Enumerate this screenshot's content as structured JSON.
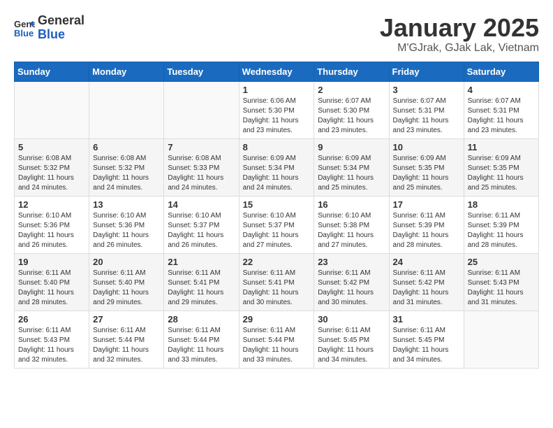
{
  "header": {
    "logo_line1": "General",
    "logo_line2": "Blue",
    "month_year": "January 2025",
    "location": "M'GJrak, GJak Lak, Vietnam"
  },
  "weekdays": [
    "Sunday",
    "Monday",
    "Tuesday",
    "Wednesday",
    "Thursday",
    "Friday",
    "Saturday"
  ],
  "weeks": [
    [
      {
        "day": "",
        "info": ""
      },
      {
        "day": "",
        "info": ""
      },
      {
        "day": "",
        "info": ""
      },
      {
        "day": "1",
        "info": "Sunrise: 6:06 AM\nSunset: 5:30 PM\nDaylight: 11 hours\nand 23 minutes."
      },
      {
        "day": "2",
        "info": "Sunrise: 6:07 AM\nSunset: 5:30 PM\nDaylight: 11 hours\nand 23 minutes."
      },
      {
        "day": "3",
        "info": "Sunrise: 6:07 AM\nSunset: 5:31 PM\nDaylight: 11 hours\nand 23 minutes."
      },
      {
        "day": "4",
        "info": "Sunrise: 6:07 AM\nSunset: 5:31 PM\nDaylight: 11 hours\nand 23 minutes."
      }
    ],
    [
      {
        "day": "5",
        "info": "Sunrise: 6:08 AM\nSunset: 5:32 PM\nDaylight: 11 hours\nand 24 minutes."
      },
      {
        "day": "6",
        "info": "Sunrise: 6:08 AM\nSunset: 5:32 PM\nDaylight: 11 hours\nand 24 minutes."
      },
      {
        "day": "7",
        "info": "Sunrise: 6:08 AM\nSunset: 5:33 PM\nDaylight: 11 hours\nand 24 minutes."
      },
      {
        "day": "8",
        "info": "Sunrise: 6:09 AM\nSunset: 5:34 PM\nDaylight: 11 hours\nand 24 minutes."
      },
      {
        "day": "9",
        "info": "Sunrise: 6:09 AM\nSunset: 5:34 PM\nDaylight: 11 hours\nand 25 minutes."
      },
      {
        "day": "10",
        "info": "Sunrise: 6:09 AM\nSunset: 5:35 PM\nDaylight: 11 hours\nand 25 minutes."
      },
      {
        "day": "11",
        "info": "Sunrise: 6:09 AM\nSunset: 5:35 PM\nDaylight: 11 hours\nand 25 minutes."
      }
    ],
    [
      {
        "day": "12",
        "info": "Sunrise: 6:10 AM\nSunset: 5:36 PM\nDaylight: 11 hours\nand 26 minutes."
      },
      {
        "day": "13",
        "info": "Sunrise: 6:10 AM\nSunset: 5:36 PM\nDaylight: 11 hours\nand 26 minutes."
      },
      {
        "day": "14",
        "info": "Sunrise: 6:10 AM\nSunset: 5:37 PM\nDaylight: 11 hours\nand 26 minutes."
      },
      {
        "day": "15",
        "info": "Sunrise: 6:10 AM\nSunset: 5:37 PM\nDaylight: 11 hours\nand 27 minutes."
      },
      {
        "day": "16",
        "info": "Sunrise: 6:10 AM\nSunset: 5:38 PM\nDaylight: 11 hours\nand 27 minutes."
      },
      {
        "day": "17",
        "info": "Sunrise: 6:11 AM\nSunset: 5:39 PM\nDaylight: 11 hours\nand 28 minutes."
      },
      {
        "day": "18",
        "info": "Sunrise: 6:11 AM\nSunset: 5:39 PM\nDaylight: 11 hours\nand 28 minutes."
      }
    ],
    [
      {
        "day": "19",
        "info": "Sunrise: 6:11 AM\nSunset: 5:40 PM\nDaylight: 11 hours\nand 28 minutes."
      },
      {
        "day": "20",
        "info": "Sunrise: 6:11 AM\nSunset: 5:40 PM\nDaylight: 11 hours\nand 29 minutes."
      },
      {
        "day": "21",
        "info": "Sunrise: 6:11 AM\nSunset: 5:41 PM\nDaylight: 11 hours\nand 29 minutes."
      },
      {
        "day": "22",
        "info": "Sunrise: 6:11 AM\nSunset: 5:41 PM\nDaylight: 11 hours\nand 30 minutes."
      },
      {
        "day": "23",
        "info": "Sunrise: 6:11 AM\nSunset: 5:42 PM\nDaylight: 11 hours\nand 30 minutes."
      },
      {
        "day": "24",
        "info": "Sunrise: 6:11 AM\nSunset: 5:42 PM\nDaylight: 11 hours\nand 31 minutes."
      },
      {
        "day": "25",
        "info": "Sunrise: 6:11 AM\nSunset: 5:43 PM\nDaylight: 11 hours\nand 31 minutes."
      }
    ],
    [
      {
        "day": "26",
        "info": "Sunrise: 6:11 AM\nSunset: 5:43 PM\nDaylight: 11 hours\nand 32 minutes."
      },
      {
        "day": "27",
        "info": "Sunrise: 6:11 AM\nSunset: 5:44 PM\nDaylight: 11 hours\nand 32 minutes."
      },
      {
        "day": "28",
        "info": "Sunrise: 6:11 AM\nSunset: 5:44 PM\nDaylight: 11 hours\nand 33 minutes."
      },
      {
        "day": "29",
        "info": "Sunrise: 6:11 AM\nSunset: 5:44 PM\nDaylight: 11 hours\nand 33 minutes."
      },
      {
        "day": "30",
        "info": "Sunrise: 6:11 AM\nSunset: 5:45 PM\nDaylight: 11 hours\nand 34 minutes."
      },
      {
        "day": "31",
        "info": "Sunrise: 6:11 AM\nSunset: 5:45 PM\nDaylight: 11 hours\nand 34 minutes."
      },
      {
        "day": "",
        "info": ""
      }
    ]
  ]
}
